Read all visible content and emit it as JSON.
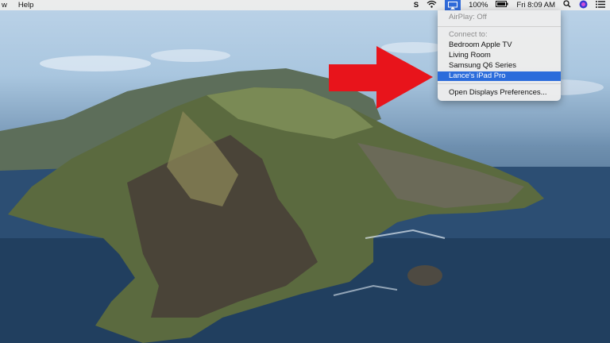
{
  "menubar": {
    "left_items": [
      "w",
      "Help"
    ],
    "battery": "100%",
    "datetime": "Fri 8:09 AM"
  },
  "airplay_menu": {
    "status": "AirPlay: Off",
    "connect_header": "Connect to:",
    "devices": [
      "Bedroom Apple TV",
      "Living Room",
      "Samsung Q6 Series",
      "Lance's iPad Pro"
    ],
    "selected_device_index": 3,
    "preferences": "Open Displays Preferences..."
  },
  "annotation": {
    "arrow_color": "#e8141b"
  },
  "colors": {
    "selection": "#2b6cdb"
  }
}
